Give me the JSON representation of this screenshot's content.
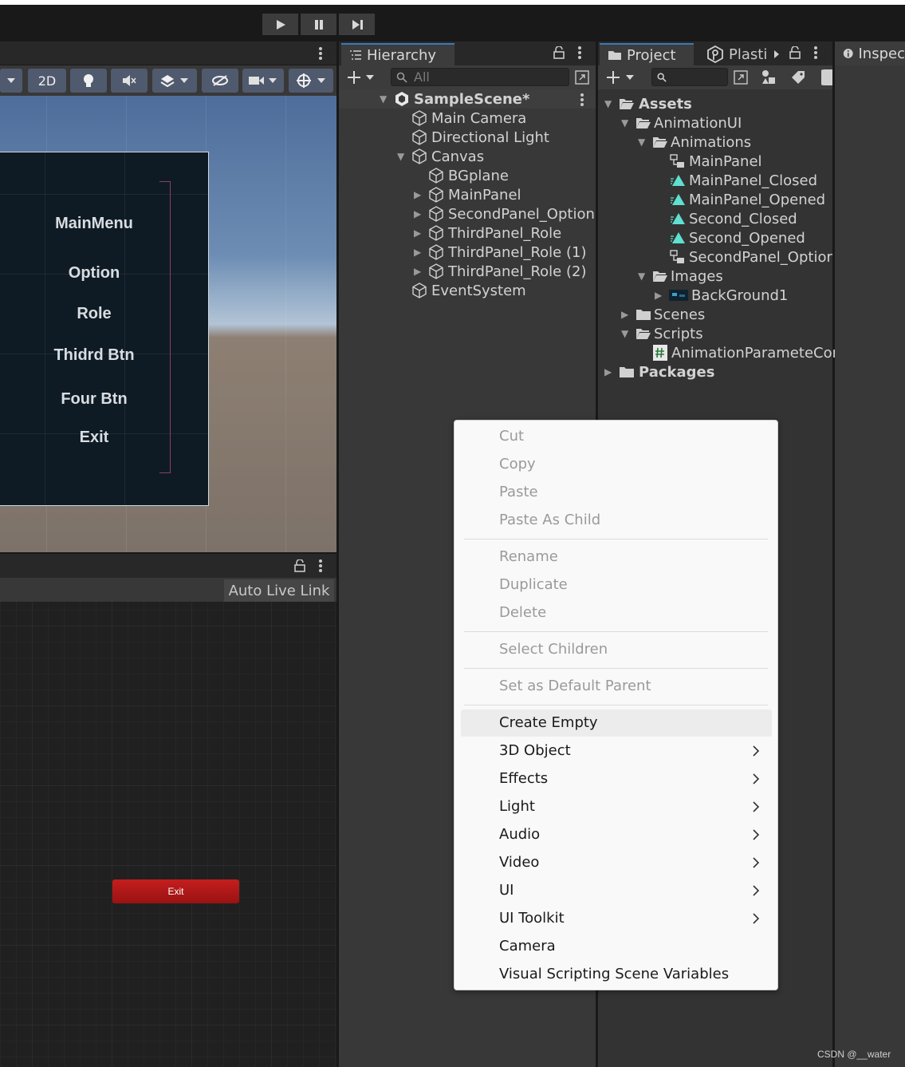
{
  "playbar": {
    "play": "play-icon",
    "pause": "pause-icon",
    "step": "step-icon"
  },
  "scene": {
    "toolbar": {
      "mode_2d": "2D"
    },
    "menu_labels": [
      "MainMenu",
      "Option",
      "Role",
      "Thidrd Btn",
      "Four Btn",
      "Exit"
    ]
  },
  "animator": {
    "auto_live_link": "Auto Live Link",
    "node_exit": "Exit"
  },
  "hierarchy": {
    "tab": "Hierarchy",
    "search_placeholder": "All",
    "scene_name": "SampleScene*",
    "items": [
      "Main Camera",
      "Directional Light",
      "Canvas",
      "BGplane",
      "MainPanel",
      "SecondPanel_Option",
      "ThirdPanel_Role",
      "ThirdPanel_Role (1)",
      "ThirdPanel_Role (2)",
      "EventSystem"
    ]
  },
  "project": {
    "tab": "Project",
    "tab_plastic": "Plasti",
    "items": [
      "Assets",
      "AnimationUI",
      "Animations",
      "MainPanel",
      "MainPanel_Closed",
      "MainPanel_Opened",
      "Second_Closed",
      "Second_Opened",
      "SecondPanel_Optior",
      "Images",
      "BackGround1",
      "Scenes",
      "Scripts",
      "AnimationParameteCor",
      "Packages"
    ]
  },
  "inspector": {
    "tab": "Inspec"
  },
  "context_menu": {
    "items": [
      "Cut",
      "Copy",
      "Paste",
      "Paste As Child",
      "Rename",
      "Duplicate",
      "Delete",
      "Select Children",
      "Set as Default Parent",
      "Create Empty",
      "3D Object",
      "Effects",
      "Light",
      "Audio",
      "Video",
      "UI",
      "UI Toolkit",
      "Camera",
      "Visual Scripting Scene Variables"
    ]
  },
  "watermark": "CSDN @__water",
  "colors": {
    "accent": "#3a79bb",
    "animator_exit": "#c41e1e",
    "anim_clip": "#5fe0d0"
  }
}
